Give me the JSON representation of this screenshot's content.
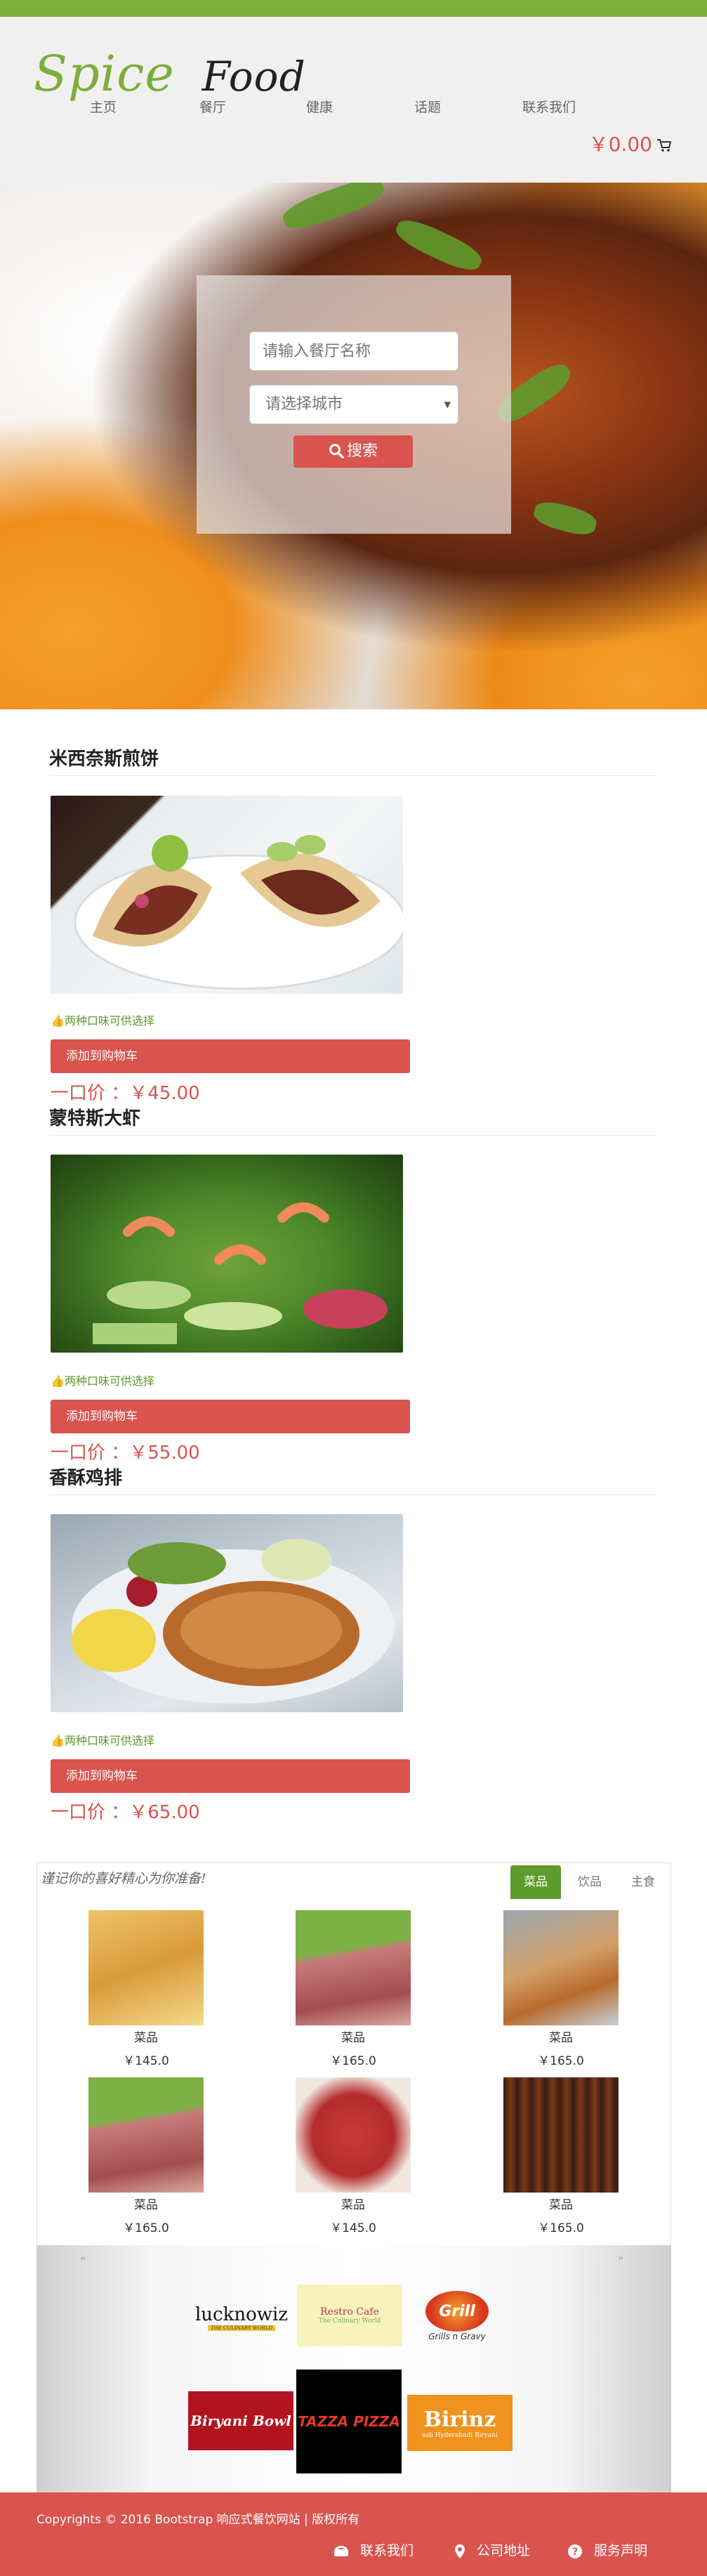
{
  "brand": {
    "logo_part1": "Spice",
    "logo_part2": "Food"
  },
  "nav": [
    "主页",
    "餐厅",
    "健康",
    "话题",
    "联系我们"
  ],
  "cart": {
    "amount": "￥0.00"
  },
  "hero": {
    "search_placeholder": "请输入餐厅名称",
    "city_placeholder": "请选择城市",
    "search_button": "搜索"
  },
  "dishes": [
    {
      "title": "米西奈斯煎饼",
      "note": "两种口味可供选择",
      "add_button": "添加到购物车",
      "price": "一口价 ：￥45.00"
    },
    {
      "title": "蒙特斯大虾",
      "note": "两种口味可供选择",
      "add_button": "添加到购物车",
      "price": "一口价 ：￥55.00"
    },
    {
      "title": "香酥鸡排",
      "note": "两种口味可供选择",
      "add_button": "添加到购物车",
      "price": "一口价 ：￥65.00"
    }
  ],
  "menu": {
    "slogan": "谨记你的喜好精心为你准备!",
    "tabs": [
      "菜品",
      "饮品",
      "主食"
    ],
    "items": [
      {
        "name": "菜品",
        "price": "￥145.0"
      },
      {
        "name": "菜品",
        "price": "￥165.0"
      },
      {
        "name": "菜品",
        "price": "￥165.0"
      },
      {
        "name": "菜品",
        "price": "￥165.0"
      },
      {
        "name": "菜品",
        "price": "￥145.0"
      },
      {
        "name": "菜品",
        "price": "￥165.0"
      }
    ]
  },
  "partners": {
    "quote_open": "“",
    "quote_close": "”",
    "logos": [
      {
        "name": "lucknowiz",
        "sub": "THE CULINARY WORLD"
      },
      {
        "name": "Restro Cafe",
        "sub": "The Culinary World"
      },
      {
        "name": "Grill",
        "sub": "Grills n Gravy"
      },
      {
        "name": "Biryani Bowl",
        "sub": ""
      },
      {
        "name": "TAZZA PIZZA",
        "sub": ""
      },
      {
        "name": "Birinz",
        "sub": "asli Hyderabadi Biryani"
      }
    ]
  },
  "footer": {
    "copyright": "Copyrights © 2016 Bootstrap 响应式餐饮网站 | 版权所有",
    "links": [
      "联系我们",
      "公司地址",
      "服务声明"
    ]
  },
  "colors": {
    "accent_red": "#d9534f",
    "accent_green": "#5e9c2d"
  }
}
